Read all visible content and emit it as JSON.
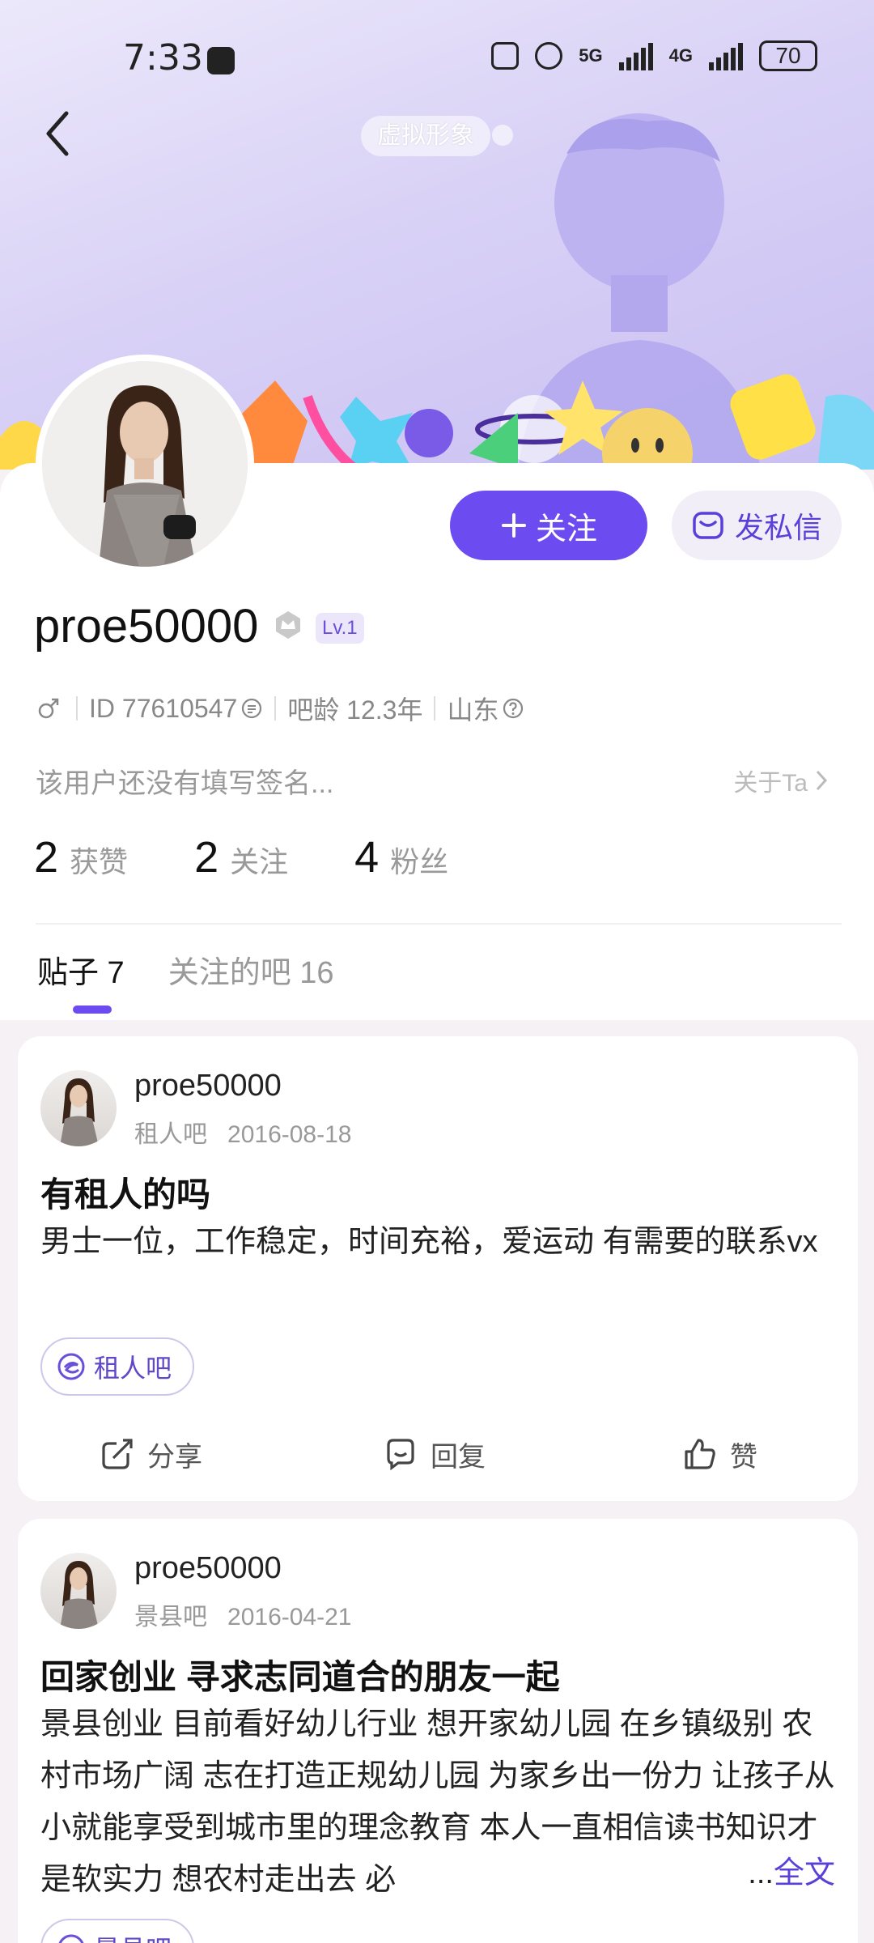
{
  "status_bar": {
    "time": "7:33",
    "signal_1": "5G",
    "signal_2": "4G",
    "battery": "70"
  },
  "header": {
    "avatar_tag": "虚拟形象"
  },
  "buttons": {
    "follow": "关注",
    "message": "发私信"
  },
  "profile": {
    "username": "proe50000",
    "level": "Lv.1",
    "id_text": "ID 77610547",
    "bar_age": "吧龄 12.3年",
    "location": "山东",
    "signature": "该用户还没有填写签名...",
    "about": "关于Ta"
  },
  "stats": [
    {
      "num": "2",
      "label": "获赞"
    },
    {
      "num": "2",
      "label": "关注"
    },
    {
      "num": "4",
      "label": "粉丝"
    }
  ],
  "tabs": [
    {
      "label": "贴子 7",
      "active": true
    },
    {
      "label": "关注的吧 16",
      "active": false
    }
  ],
  "posts": [
    {
      "user": "proe50000",
      "forum": "租人吧",
      "date": "2016-08-18",
      "title": "有租人的吗",
      "body": "男士一位，工作稳定，时间充裕，爱运动 有需要的联系vx",
      "chip": "租人吧",
      "actions": {
        "share": "分享",
        "reply": "回复",
        "like": "赞"
      }
    },
    {
      "user": "proe50000",
      "forum": "景县吧",
      "date": "2016-04-21",
      "title": "回家创业 寻求志同道合的朋友一起",
      "body": "景县创业 目前看好幼儿行业 想开家幼儿园 在乡镇级别 农村市场广阔 志在打造正规幼儿园 为家乡出一份力 让孩子从小就能享受到城市里的理念教育 本人一直相信读书知识才是软实力 想农村走出去 必",
      "more_dots": "...",
      "more": "全文",
      "chip": "景县吧"
    }
  ]
}
